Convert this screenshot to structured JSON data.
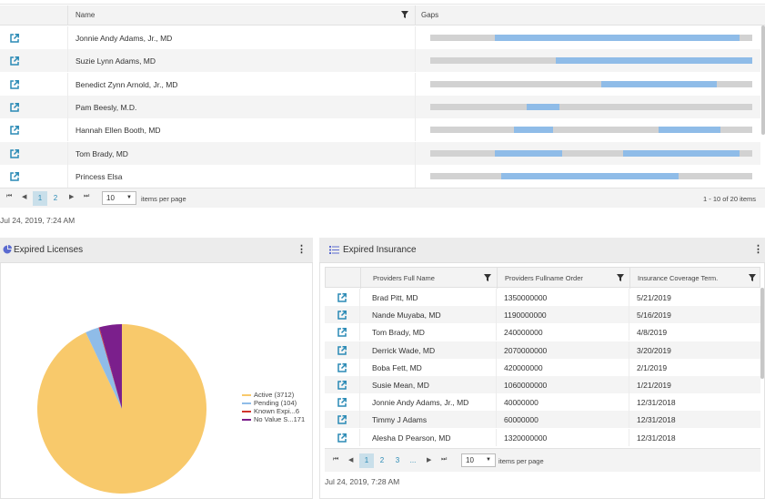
{
  "top_grid": {
    "headers": {
      "name": "Name",
      "gaps": "Gaps"
    },
    "rows": [
      {
        "name": "Jonnie Andy Adams, Jr., MD",
        "gaps": [
          [
            0.2,
            0.96
          ]
        ]
      },
      {
        "name": "Suzie Lynn Adams, MD",
        "gaps": [
          [
            0.39,
            1.0
          ]
        ]
      },
      {
        "name": "Benedict Zynn Arnold, Jr., MD",
        "gaps": [
          [
            0.53,
            0.89
          ]
        ]
      },
      {
        "name": "Pam Beesly, M.D.",
        "gaps": [
          [
            0.3,
            0.4
          ]
        ]
      },
      {
        "name": "Hannah Ellen Booth, MD",
        "gaps": [
          [
            0.26,
            0.38
          ],
          [
            0.71,
            0.9
          ]
        ]
      },
      {
        "name": "Tom Brady, MD",
        "gaps": [
          [
            0.2,
            0.41
          ],
          [
            0.6,
            0.96
          ]
        ]
      },
      {
        "name": "Princess Elsa",
        "gaps": [
          [
            0.22,
            0.77
          ]
        ]
      }
    ],
    "pager": {
      "pages": [
        "1",
        "2"
      ],
      "active_page": "1",
      "page_size": "10",
      "items_per_page_label": "items per page",
      "info": "1 - 10 of 20 items"
    },
    "timestamp": "Jul 24, 2019, 7:24 AM"
  },
  "licenses": {
    "title": "Expired Licenses",
    "chart_data": {
      "type": "pie",
      "slices": [
        {
          "label": "Active (3712)",
          "value": 3712,
          "color": "#f8c96b"
        },
        {
          "label": "Pending (104)",
          "value": 104,
          "color": "#8fbce8"
        },
        {
          "label": "Known Expi...6",
          "value": 6,
          "color": "#d0342c"
        },
        {
          "label": "No Value S...171",
          "value": 171,
          "color": "#7b1f8c"
        }
      ],
      "legend_position": "right"
    }
  },
  "insurance": {
    "title": "Expired Insurance",
    "headers": {
      "c1": "Providers Full Name",
      "c2": "Providers Fullname Order",
      "c3": "Insurance Coverage Term."
    },
    "rows": [
      {
        "name": "Brad Pitt, MD",
        "order": "1350000000",
        "term": "5/21/2019"
      },
      {
        "name": "Nande Muyaba, MD",
        "order": "1190000000",
        "term": "5/16/2019"
      },
      {
        "name": "Tom Brady, MD",
        "order": "240000000",
        "term": "4/8/2019"
      },
      {
        "name": "Derrick Wade, MD",
        "order": "2070000000",
        "term": "3/20/2019"
      },
      {
        "name": "Boba Fett, MD",
        "order": "420000000",
        "term": "2/1/2019"
      },
      {
        "name": "Susie Mean, MD",
        "order": "1060000000",
        "term": "1/21/2019"
      },
      {
        "name": "Jonnie Andy Adams, Jr., MD",
        "order": "40000000",
        "term": "12/31/2018"
      },
      {
        "name": "Timmy J Adams",
        "order": "60000000",
        "term": "12/31/2018"
      },
      {
        "name": "Alesha D Pearson, MD",
        "order": "1320000000",
        "term": "12/31/2018"
      }
    ],
    "pager": {
      "pages": [
        "1",
        "2",
        "3",
        "..."
      ],
      "active_page": "1",
      "page_size": "10",
      "items_per_page_label": "items per page"
    },
    "timestamp": "Jul 24, 2019, 7:28 AM"
  },
  "colors": {
    "accent": "#2a8ab5",
    "gap_fill": "#8fbce8",
    "gap_track": "#d2d2d2"
  }
}
